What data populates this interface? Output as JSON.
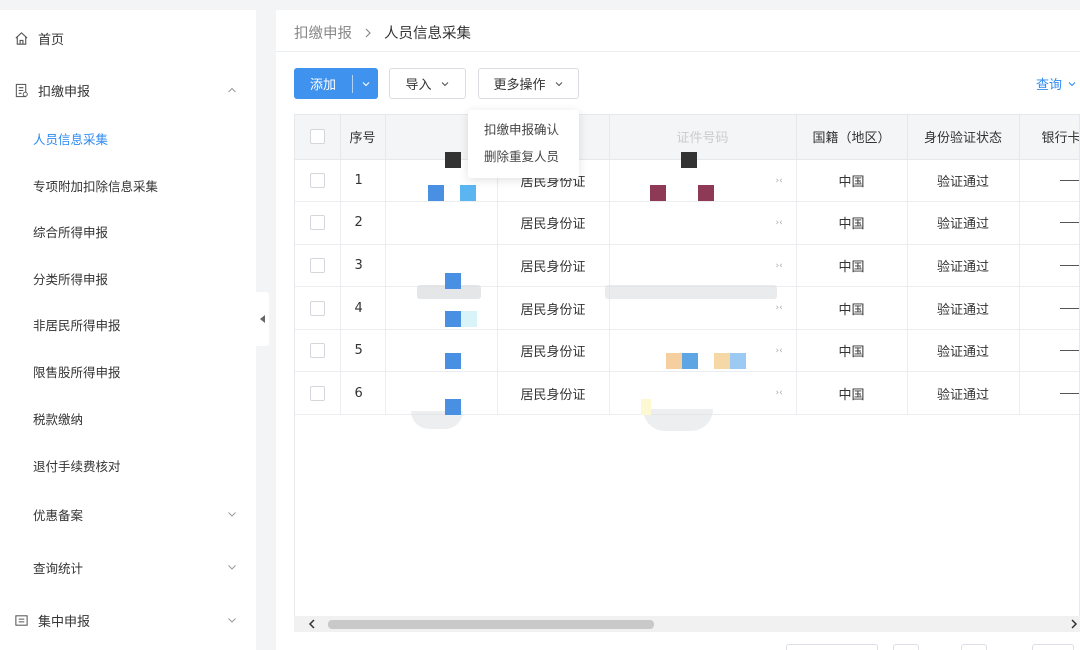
{
  "sidebar": {
    "items": [
      {
        "label": "首页",
        "icon": "home-icon"
      },
      {
        "label": "扣缴申报",
        "icon": "declaration-icon",
        "expanded": true
      },
      {
        "label": "人员信息采集",
        "active": true
      },
      {
        "label": "专项附加扣除信息采集"
      },
      {
        "label": "综合所得申报"
      },
      {
        "label": "分类所得申报"
      },
      {
        "label": "非居民所得申报"
      },
      {
        "label": "限售股所得申报"
      },
      {
        "label": "税款缴纳"
      },
      {
        "label": "退付手续费核对"
      },
      {
        "label": "优惠备案",
        "expandable": true
      },
      {
        "label": "查询统计",
        "expandable": true
      },
      {
        "label": "集中申报",
        "icon": "centralized-report-icon",
        "expandable": true
      }
    ]
  },
  "breadcrumb": {
    "parent": "扣缴申报",
    "current": "人员信息采集"
  },
  "toolbar": {
    "add_label": "添加",
    "import_label": "导入",
    "more_label": "更多操作",
    "query_label": "查询"
  },
  "dropdown_menu": {
    "items": [
      "扣缴申报确认",
      "删除重复人员"
    ]
  },
  "table": {
    "headers": {
      "seq": "序号",
      "name": "",
      "id_type": "",
      "id_number": "证件号码",
      "nationality": "国籍（地区）",
      "verify_status": "身份验证状态",
      "bank_card": "银行卡"
    },
    "rows": [
      {
        "seq": "1",
        "id_type": "居民身份证",
        "nationality": "中国",
        "verify_status": "验证通过"
      },
      {
        "seq": "2",
        "id_type": "居民身份证",
        "nationality": "中国",
        "verify_status": "验证通过"
      },
      {
        "seq": "3",
        "id_type": "居民身份证",
        "nationality": "中国",
        "verify_status": "验证通过"
      },
      {
        "seq": "4",
        "id_type": "居民身份证",
        "nationality": "中国",
        "verify_status": "验证通过"
      },
      {
        "seq": "5",
        "id_type": "居民身份证",
        "nationality": "中国",
        "verify_status": "验证通过"
      },
      {
        "seq": "6",
        "id_type": "居民身份证",
        "nationality": "中国",
        "verify_status": "验证通过"
      }
    ]
  },
  "colors": {
    "accent": "#3f93ee",
    "link": "#2f8bf0",
    "header_bg": "#f4f5f7"
  }
}
